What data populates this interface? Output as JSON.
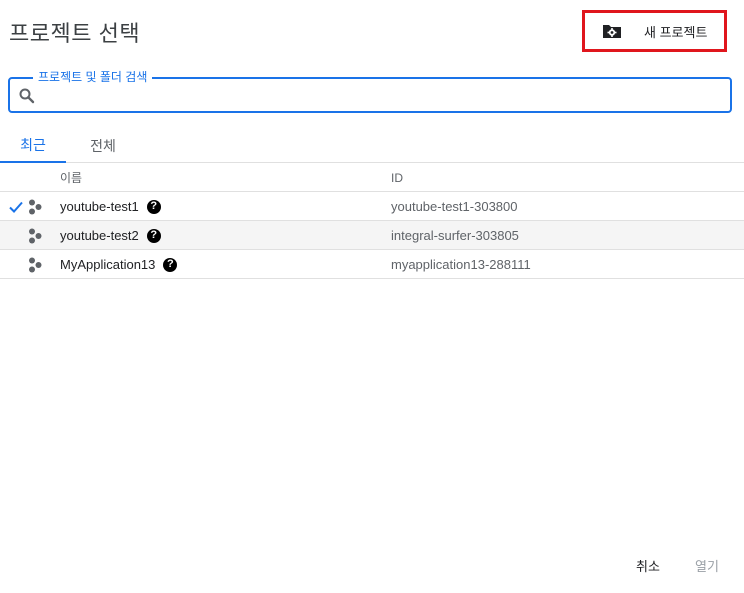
{
  "dialog": {
    "title": "프로젝트 선택",
    "new_project_label": "새 프로젝트"
  },
  "search": {
    "label": "프로젝트 및 폴더 검색",
    "value": "",
    "placeholder": ""
  },
  "tabs": [
    {
      "label": "최근",
      "active": true
    },
    {
      "label": "전체",
      "active": false
    }
  ],
  "table": {
    "headers": {
      "name": "이름",
      "id": "ID"
    },
    "rows": [
      {
        "name": "youtube-test1",
        "id": "youtube-test1-303800",
        "selected": true,
        "help": "?"
      },
      {
        "name": "youtube-test2",
        "id": "integral-surfer-303805",
        "selected": false,
        "help": "?"
      },
      {
        "name": "MyApplication13",
        "id": "myapplication13-288111",
        "selected": false,
        "help": "?"
      }
    ]
  },
  "footer": {
    "cancel_label": "취소",
    "open_label": "열기"
  },
  "colors": {
    "accent": "#1a73e8",
    "highlight_border": "#e0161d"
  },
  "icons": {
    "new_project": "folder-gear-icon",
    "search": "search-icon",
    "selected": "check-icon",
    "project": "project-nodes-icon",
    "help": "help-circle-icon"
  }
}
